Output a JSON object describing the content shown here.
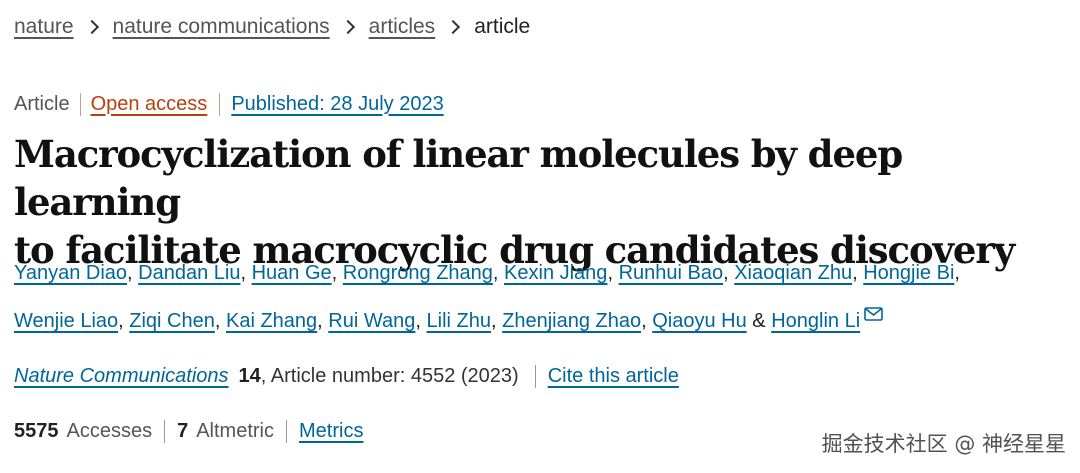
{
  "breadcrumb": {
    "items": [
      "nature",
      "nature communications",
      "articles"
    ],
    "current": "article"
  },
  "meta": {
    "type": "Article",
    "access": "Open access",
    "published": "Published: 28 July 2023"
  },
  "title": {
    "line1": "Macrocyclization of linear molecules by deep learning",
    "line2": "to facilitate macrocyclic drug candidates discovery"
  },
  "authors": [
    "Yanyan Diao",
    "Dandan Liu",
    "Huan Ge",
    "Rongrong Zhang",
    "Kexin Jiang",
    "Runhui Bao",
    "Xiaoqian Zhu",
    "Hongjie Bi",
    "Wenjie Liao",
    "Ziqi Chen",
    "Kai Zhang",
    "Rui Wang",
    "Lili Zhu",
    "Zhenjiang Zhao",
    "Qiaoyu Hu",
    "Honglin Li"
  ],
  "author_separators": {
    "comma": ",",
    "ampersand": "&"
  },
  "icons": {
    "mail": "mail-icon"
  },
  "citation": {
    "journal": "Nature Communications",
    "volume": "14",
    "details": ", Article number: 4552 (2023)",
    "cite": "Cite this article"
  },
  "metrics": {
    "accesses_count": "5575",
    "accesses_label": "Accesses",
    "altmetric_count": "7",
    "altmetric_label": "Altmetric",
    "metrics_link": "Metrics"
  },
  "watermark": {
    "text": "掘金技术社区 @ 神经星星"
  },
  "colors": {
    "link": "#006699",
    "open_access": "#b7410e",
    "text": "#222222"
  }
}
